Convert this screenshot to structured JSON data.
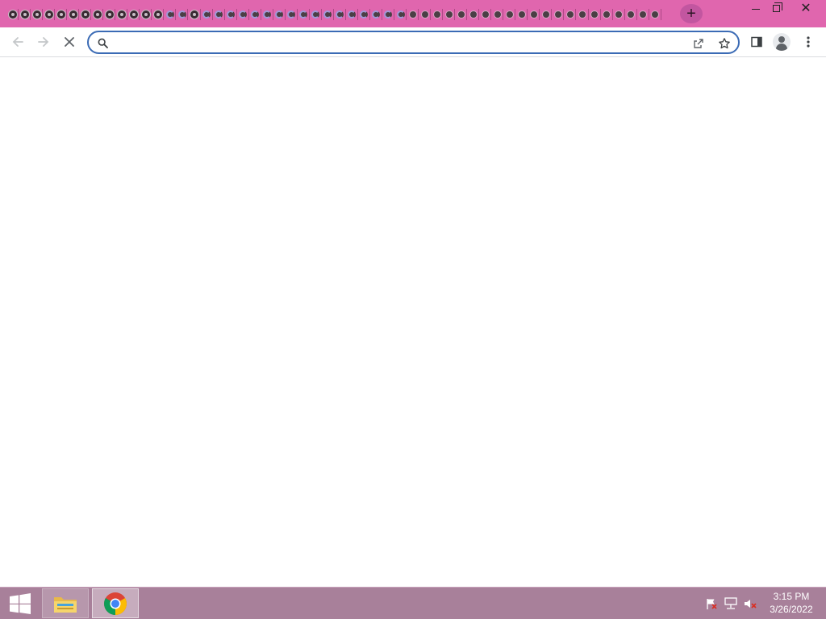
{
  "browser": {
    "tab_strip_color": "#e066ae",
    "tabs": [
      {
        "state": "crashed"
      },
      {
        "state": "crashed"
      },
      {
        "state": "crashed"
      },
      {
        "state": "crashed"
      },
      {
        "state": "crashed"
      },
      {
        "state": "crashed"
      },
      {
        "state": "crashed"
      },
      {
        "state": "crashed"
      },
      {
        "state": "crashed"
      },
      {
        "state": "crashed"
      },
      {
        "state": "crashed"
      },
      {
        "state": "crashed"
      },
      {
        "state": "crashed"
      },
      {
        "state": "loading"
      },
      {
        "state": "loading"
      },
      {
        "state": "crashed"
      },
      {
        "state": "loading"
      },
      {
        "state": "loading"
      },
      {
        "state": "loading"
      },
      {
        "state": "loading"
      },
      {
        "state": "loading"
      },
      {
        "state": "loading"
      },
      {
        "state": "loading"
      },
      {
        "state": "loading"
      },
      {
        "state": "loading"
      },
      {
        "state": "loading"
      },
      {
        "state": "loading"
      },
      {
        "state": "loading"
      },
      {
        "state": "loading"
      },
      {
        "state": "loading"
      },
      {
        "state": "loading"
      },
      {
        "state": "loading"
      },
      {
        "state": "loading"
      },
      {
        "state": "plain"
      },
      {
        "state": "plain"
      },
      {
        "state": "plain"
      },
      {
        "state": "plain"
      },
      {
        "state": "plain"
      },
      {
        "state": "plain"
      },
      {
        "state": "plain"
      },
      {
        "state": "plain"
      },
      {
        "state": "plain"
      },
      {
        "state": "plain"
      },
      {
        "state": "plain"
      },
      {
        "state": "plain"
      },
      {
        "state": "plain"
      },
      {
        "state": "plain"
      },
      {
        "state": "plain"
      },
      {
        "state": "plain"
      },
      {
        "state": "plain"
      },
      {
        "state": "plain"
      },
      {
        "state": "plain"
      },
      {
        "state": "plain"
      },
      {
        "state": "plain"
      }
    ],
    "new_tab_symbol": "+",
    "window_controls": {
      "minimize_icon": "minimize-icon",
      "restore_icon": "restore-icon",
      "close_symbol": "✕"
    },
    "toolbar": {
      "back_icon": "back-arrow-icon",
      "forward_icon": "forward-arrow-icon",
      "stop_icon": "stop-loading-icon",
      "omnibox": {
        "value": "",
        "placeholder": "",
        "search_icon": "search-icon",
        "share_icon": "share-icon",
        "bookmark_icon": "star-icon"
      },
      "side_panel_icon": "side-panel-icon",
      "profile_icon": "profile-icon",
      "menu_icon": "kebab-menu-icon",
      "omnibox_focus_color": "#3b6bb5"
    }
  },
  "taskbar": {
    "color": "#a8809a",
    "start_icon": "windows-logo-icon",
    "pinned": [
      {
        "name": "File Explorer",
        "icon": "folder-icon"
      },
      {
        "name": "Google Chrome",
        "icon": "chrome-icon",
        "active": true
      }
    ],
    "tray": {
      "flag_icon": "action-center-flag-icon",
      "network_icon": "network-icon",
      "volume_icon": "volume-muted-icon"
    },
    "clock": {
      "time": "3:15 PM",
      "date": "3/26/2022"
    }
  }
}
